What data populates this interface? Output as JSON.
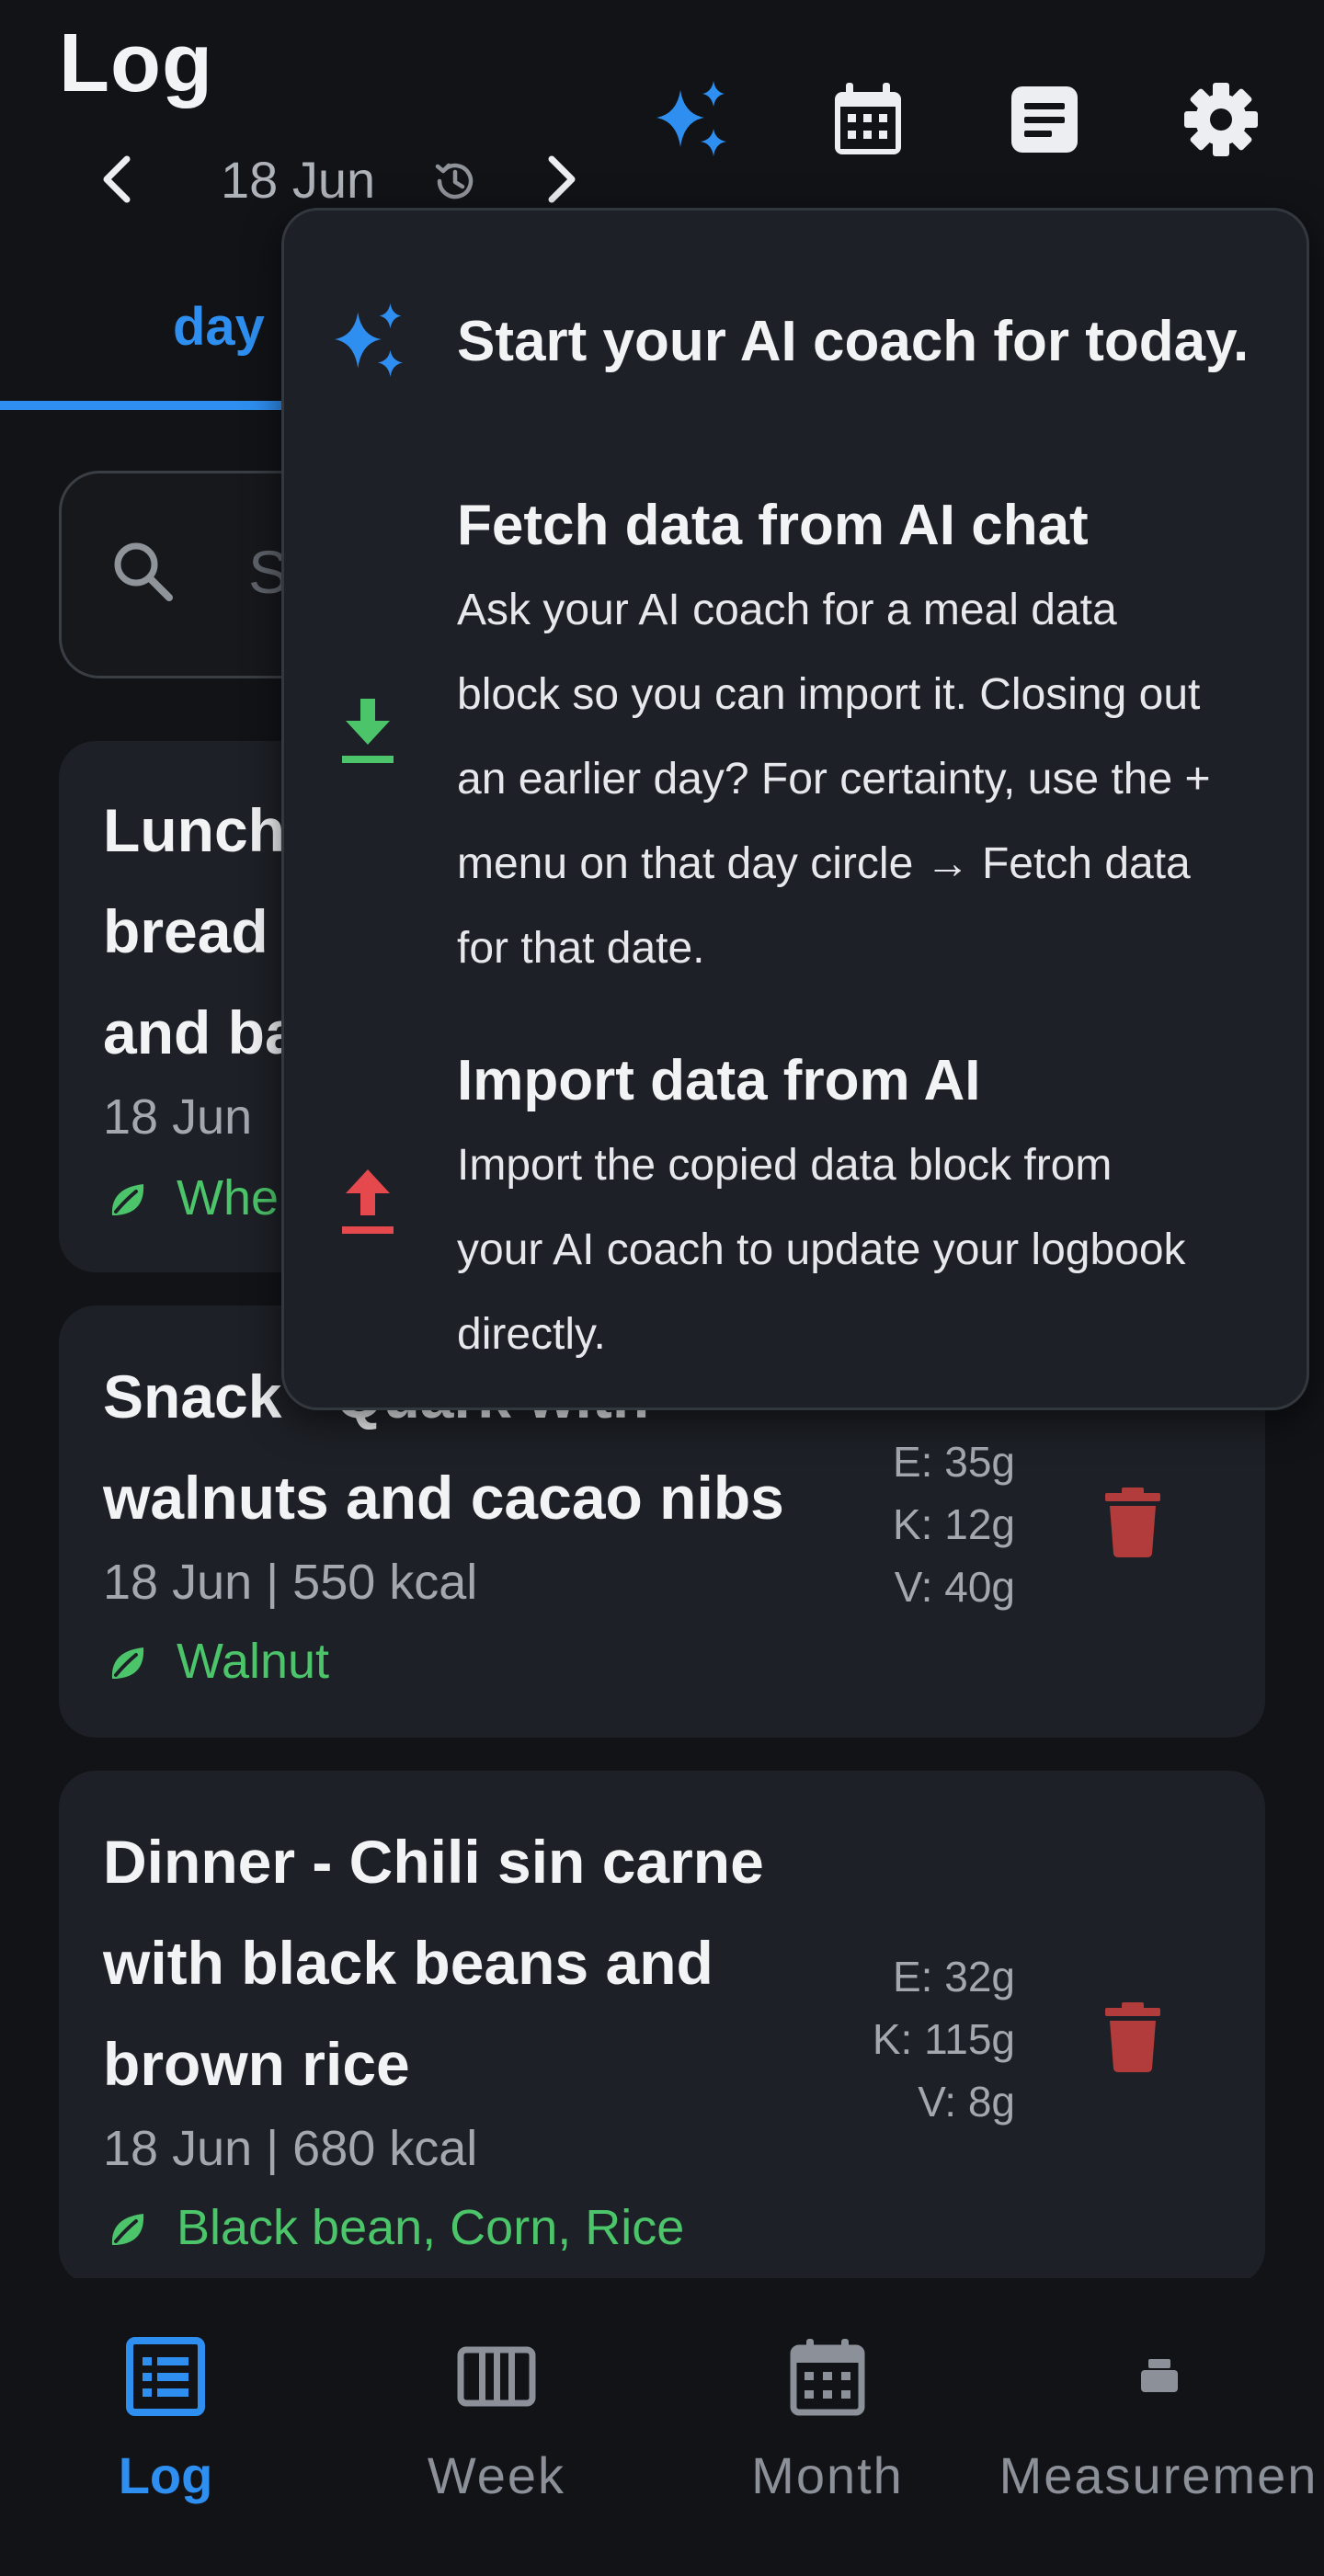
{
  "header": {
    "title": "Log",
    "date": "18 Jun",
    "icons": [
      "sparkles-icon",
      "calendar-icon",
      "notes-icon",
      "gear-icon"
    ]
  },
  "tabs": {
    "active": "day"
  },
  "search": {
    "placeholder": "S"
  },
  "meals": [
    {
      "title_lines": [
        "Lunch",
        "bread",
        "and ba"
      ],
      "meta": "18 Jun",
      "tags": "Whe"
    },
    {
      "title_lines": [
        "Snack - Quark with",
        "walnuts and cacao nibs"
      ],
      "meta": "18 Jun | 550 kcal",
      "tags": "Walnut",
      "macros": [
        "E: 35g",
        "K: 12g",
        "V: 40g"
      ]
    },
    {
      "title_lines": [
        "Dinner - Chili sin carne",
        "with black beans and",
        "brown rice"
      ],
      "meta": "18 Jun | 680 kcal",
      "tags": "Black bean, Corn, Rice",
      "macros": [
        "E: 32g",
        "K: 115g",
        "V: 8g"
      ]
    }
  ],
  "popup": {
    "header": "Start your AI coach for today.",
    "fetch": {
      "title": "Fetch data from AI chat",
      "desc_lines": [
        "Ask your AI coach for a meal data",
        "block so you can import it. Closing out",
        "an earlier day? For certainty, use the +",
        "menu on that day circle → Fetch data",
        "for that date."
      ]
    },
    "import": {
      "title": "Import data from AI",
      "desc_lines": [
        "Import the copied data block from",
        "your AI coach to update your logbook",
        "directly."
      ]
    }
  },
  "nav": [
    {
      "label": "Log",
      "icon": "list-icon",
      "active": true
    },
    {
      "label": "Week",
      "icon": "week-columns-icon",
      "active": false
    },
    {
      "label": "Month",
      "icon": "calendar-icon",
      "active": false
    },
    {
      "label": "Measuremen",
      "icon": "scale-icon",
      "active": false
    }
  ],
  "colors": {
    "background": "#111317",
    "card": "#1d2026",
    "accent": "#2e8ff0",
    "tag_green": "#4cc56a",
    "delete_red": "#b23b3b",
    "import_red": "#e5484d"
  }
}
